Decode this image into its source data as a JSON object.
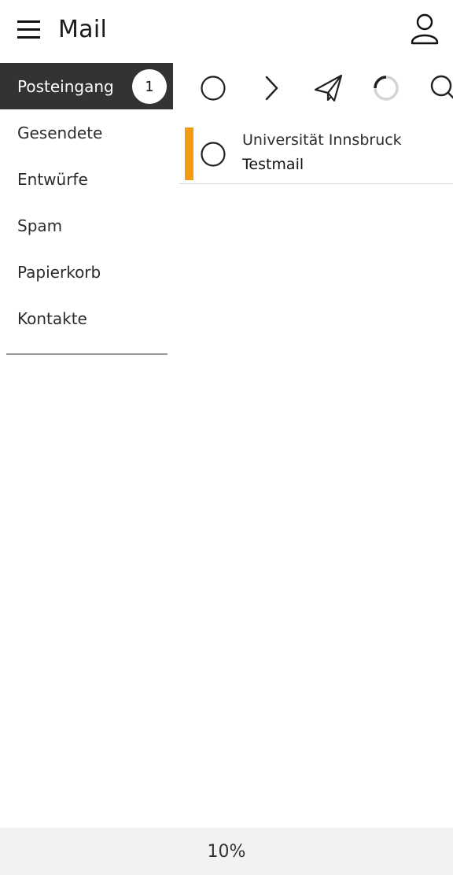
{
  "header": {
    "title": "Mail",
    "menu_icon": "hamburger-icon",
    "account_icon": "user-icon"
  },
  "sidebar": {
    "items": [
      {
        "label": "Posteingang",
        "badge": "1",
        "active": true
      },
      {
        "label": "Gesendete"
      },
      {
        "label": "Entwürfe"
      },
      {
        "label": "Spam"
      },
      {
        "label": "Papierkorb"
      },
      {
        "label": "Kontakte"
      }
    ]
  },
  "toolbar": {
    "icons": [
      "select-all-circle-icon",
      "chevron-right-icon",
      "paper-plane-icon",
      "loading-spinner-icon",
      "search-icon"
    ]
  },
  "messages": [
    {
      "sender": "Universität Innsbruck",
      "subject": "Testmail",
      "unread": true
    }
  ],
  "colors": {
    "active_bg": "#333333",
    "unread_marker": "#f39c12",
    "footer_bg": "#f2f2f2"
  },
  "footer": {
    "zoom": "10%"
  }
}
